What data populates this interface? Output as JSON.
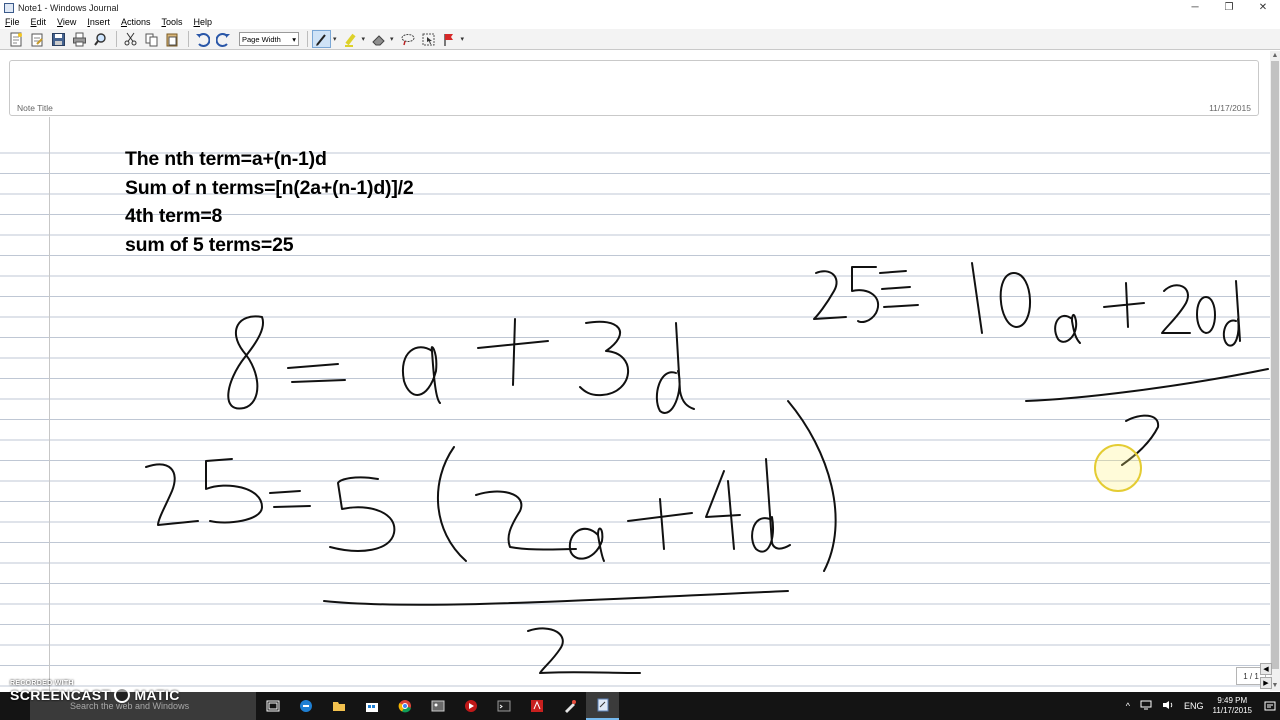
{
  "window": {
    "title": "Note1 - Windows Journal",
    "minimize_glyph": "─",
    "maximize_glyph": "❐",
    "close_glyph": "✕"
  },
  "menu": [
    {
      "id": "file",
      "label": "File"
    },
    {
      "id": "edit",
      "label": "Edit"
    },
    {
      "id": "view",
      "label": "View"
    },
    {
      "id": "insert",
      "label": "Insert"
    },
    {
      "id": "actions",
      "label": "Actions"
    },
    {
      "id": "tools",
      "label": "Tools"
    },
    {
      "id": "help",
      "label": "Help"
    }
  ],
  "toolbar": {
    "zoom_value": "Page Width",
    "dropdown_glyph": "▾",
    "icons": [
      "new-note-icon",
      "open-icon",
      "save-icon",
      "print-icon",
      "find-icon",
      "cut-icon",
      "copy-icon",
      "paste-icon",
      "undo-icon",
      "redo-icon",
      "pen-icon",
      "highlighter-icon",
      "eraser-icon",
      "lasso-select-icon",
      "selection-tool-icon",
      "flag-icon"
    ]
  },
  "note": {
    "title_placeholder": "Note Title",
    "date": "11/17/2015"
  },
  "typed_lines": [
    "The nth term=a+(n-1)d",
    "Sum of n terms=[n(2a+(n-1)d)]/2",
    "4th term=8",
    "sum of 5 terms=25"
  ],
  "page_counter": "1 / 1",
  "scroll_arrows": {
    "up": "▲",
    "down": "▼"
  },
  "page_nav": {
    "prev": "◀",
    "next": "▶"
  },
  "watermark": {
    "top": "RECORDED WITH",
    "brand_left": "SCREENCAST",
    "brand_right": "MATIC"
  },
  "taskbar": {
    "search_placeholder": "Search the web and Windows",
    "apps": [
      "task-view-icon",
      "edge-icon",
      "file-explorer-icon",
      "store-icon",
      "chrome-icon",
      "photos-icon",
      "media-icon",
      "terminal-icon",
      "acrobat-icon",
      "paint-icon",
      "journal-icon"
    ],
    "tray": {
      "chevron": "^",
      "language": "ENG",
      "time": "9:49 PM",
      "date": "11/17/2015"
    }
  },
  "colors": {
    "ink": "#111111",
    "rule_line": "#bfc7d4",
    "taskbar": "#141414",
    "cursor_highlight": "#e4cc33"
  }
}
